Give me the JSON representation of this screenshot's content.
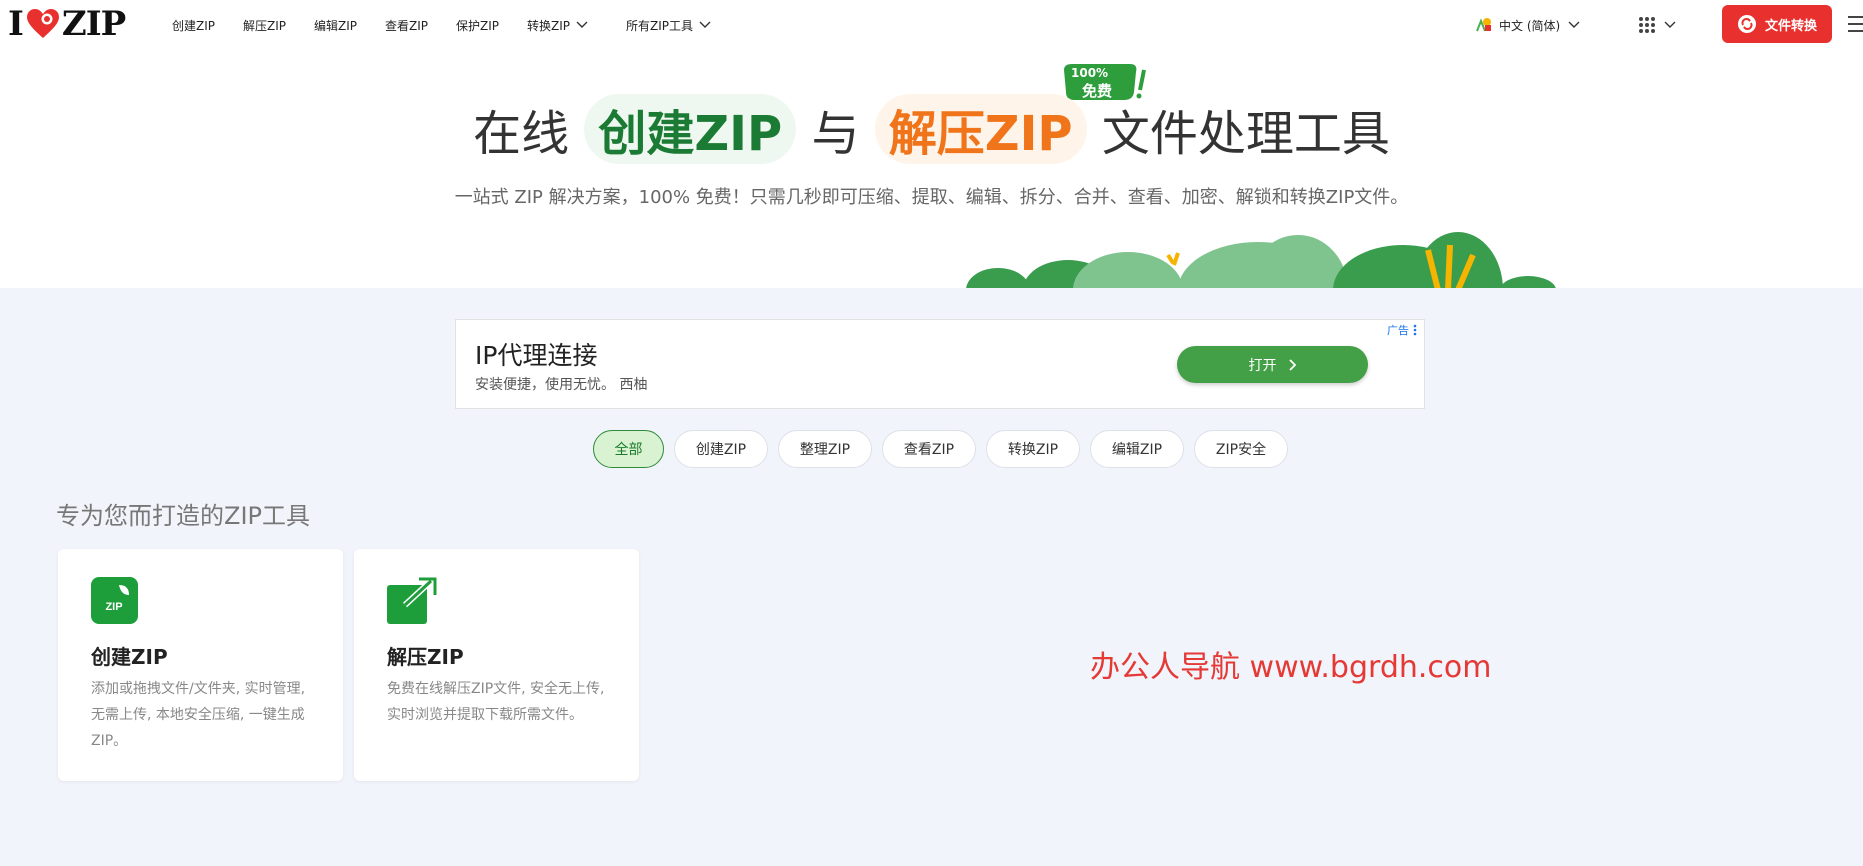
{
  "header": {
    "logo": {
      "left": "I",
      "right": "ZIP"
    },
    "nav": [
      {
        "label": "创建ZIP"
      },
      {
        "label": "解压ZIP"
      },
      {
        "label": "编辑ZIP"
      },
      {
        "label": "查看ZIP"
      },
      {
        "label": "保护ZIP"
      },
      {
        "label": "转换ZIP"
      },
      {
        "label": "所有ZIP工具"
      }
    ],
    "language": "中文 (简体)",
    "convert_button": "文件转换"
  },
  "hero": {
    "title_prefix": "在线",
    "title_green": "创建ZIP",
    "title_mid": "与",
    "title_orange": "解压ZIP",
    "title_suffix": "文件处理工具",
    "badge_top": "100%",
    "badge_bottom": "免费",
    "subtitle": "一站式 ZIP 解决方案，100% 免费！只需几秒即可压缩、提取、编辑、拆分、合并、查看、加密、解锁和转换ZIP文件。"
  },
  "ad": {
    "title": "IP代理连接",
    "description": "安装便捷，使用无忧。 西柚",
    "button": "打开",
    "label": "广告"
  },
  "filters": [
    {
      "label": "全部",
      "active": true
    },
    {
      "label": "创建ZIP",
      "active": false
    },
    {
      "label": "整理ZIP",
      "active": false
    },
    {
      "label": "查看ZIP",
      "active": false
    },
    {
      "label": "转换ZIP",
      "active": false
    },
    {
      "label": "编辑ZIP",
      "active": false
    },
    {
      "label": "ZIP安全",
      "active": false
    }
  ],
  "section_title": "专为您而打造的ZIP工具",
  "cards": [
    {
      "title": "创建ZIP",
      "icon": "zip-file-icon",
      "icon_text": "ZIP",
      "description": "添加或拖拽文件/文件夹, 实时管理, 无需上传, 本地安全压缩, 一键生成ZIP。"
    },
    {
      "title": "解压ZIP",
      "icon": "extract-arrow-icon",
      "description": "免费在线解压ZIP文件, 安全无上传, 实时浏览并提取下载所需文件。"
    }
  ],
  "watermark": "办公人导航  www.bgrdh.com",
  "colors": {
    "brand_red": "#e8312f",
    "green": "#1b7a33",
    "orange": "#f0741a",
    "chip_active": "#d8f2d2"
  }
}
